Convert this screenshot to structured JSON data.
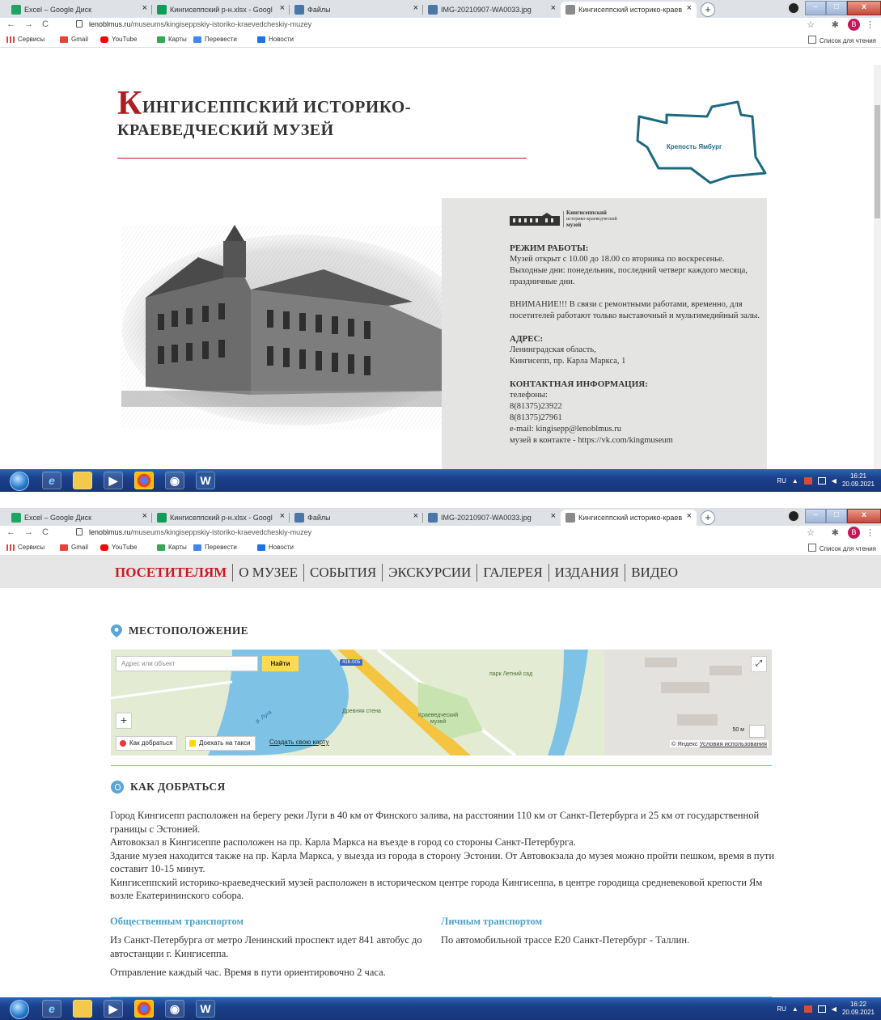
{
  "browser": {
    "tabs": [
      {
        "label": "Excel – Google Диск",
        "icon": "google-drive-icon",
        "color": "#1fa463"
      },
      {
        "label": "Кингисеппский р-н.xlsx - Googl",
        "icon": "google-sheets-icon",
        "color": "#0f9d58"
      },
      {
        "label": "Файлы",
        "icon": "vk-icon",
        "color": "#4a76a8"
      },
      {
        "label": "IMG-20210907-WA0033.jpg",
        "icon": "vk-icon",
        "color": "#4a76a8"
      },
      {
        "label": "Кингисеппский историко-краев",
        "icon": "site-favicon",
        "color": "#8a8a8a"
      }
    ],
    "url_host": "lenoblmus.ru",
    "url_path": "/museums/kingiseppskiy-istoriko-kraevedcheskiy-muzey",
    "avatar_letter": "B",
    "bookmarks": [
      "Сервисы",
      "Gmail",
      "YouTube",
      "Карты",
      "Перевести",
      "Новости"
    ],
    "reading_list": "Список для чтения"
  },
  "taskbar": {
    "lang": "RU",
    "shot1_time": "16:21",
    "shot1_date": "20.09.2021",
    "shot2_time": "16:22",
    "shot2_date": "20.09.2021"
  },
  "header": {
    "title_first_letter": "К",
    "title_line1_rest": "ИНГИСЕППСКИЙ ИСТОРИКО-",
    "title_line2": "КРАЕВЕДЧЕСКИЙ МУЗЕЙ",
    "fortress_label": "Крепость Ямбург"
  },
  "info": {
    "logo_line1": "Кингисеппский",
    "logo_line2": "историко-краеведческий",
    "logo_line3": "музей",
    "hours_title": "РЕЖИМ РАБОТЫ:",
    "hours_text": "Музей открыт с 10.00 до 18.00 со вторника по воскресенье. Выходные дни: понедельник, последний четверг каждого месяца, праздничные дни.",
    "notice_text": "ВНИМАНИЕ!!! В связи с ремонтными работами, временно, для посетителей работают только выставочный и мультимедийный залы.",
    "address_title": "АДРЕС:",
    "address_line1": "Ленинградская область,",
    "address_line2": "Кингисепп, пр. Карла Маркса, 1",
    "contact_title": "КОНТАКТНАЯ ИНФОРМАЦИЯ:",
    "phones_label": "телефоны:",
    "phone1": "8(81375)23922",
    "phone2": "8(81375)27961",
    "email": "e-mail: kingisepp@lenoblmus.ru",
    "vk": "музей в контакте - https://vk.com/kingmuseum"
  },
  "nav": {
    "items": [
      "ПОСЕТИТЕЛЯМ",
      "О МУЗЕЕ",
      "СОБЫТИЯ",
      "ЭКСКУРСИИ",
      "ГАЛЕРЕЯ",
      "ИЗДАНИЯ",
      "ВИДЕО"
    ],
    "active": "ПОСЕТИТЕЛЯМ",
    "active_color": "#c8181f"
  },
  "location": {
    "title": "МЕСТОПОЛОЖЕНИЕ"
  },
  "map": {
    "search_placeholder": "Адрес или объект",
    "find_label": "Найти",
    "route_button": "Как добраться",
    "taxi_button": "Доехать на такси",
    "create_map": "Создать свою карту",
    "road_tag": "41К-005",
    "park_label": "парк Летний сад",
    "wall_label": "Древняя стена",
    "museum_label_1": "Краеведческий",
    "museum_label_2": "музей",
    "river_label": "р. Луга",
    "scale": "50 м",
    "copyright": "© Яндекс",
    "terms": "Условия использования"
  },
  "directions": {
    "title": "КАК ДОБРАТЬСЯ",
    "p1": "Город Кингисепп расположен на берегу реки Луги в 40 км от Финского залива, на расстоянии 110 км от Санкт-Петербурга и 25 км от государственной границы с Эстонией.",
    "p2": "Автовокзал в Кингисеппе расположен на пр. Карла Маркса на въезде в город со стороны Санкт-Петербурга.",
    "p3": "Здание музея находится также на пр. Карла Маркса, у выезда из города в сторону Эстонии. От Автовокзала до музея можно пройти пешком, время в пути составит 10-15 минут.",
    "p4": "Кингисеппский историко-краеведческий музей расположен в историческом центре города Кингисеппа, в центре городища средневековой крепости Ям возле Екатерининского собора.",
    "public_title": "Общественным транспортом",
    "public_text": "Из Санкт-Петербурга от метро Ленинский проспект идет 841 автобус до автостанции г. Кингисеппа.",
    "public_text2": "Отправление каждый час. Время в пути ориентировочно 2 часа.",
    "car_title": "Личным транспортом",
    "car_text": "По автомобильной трассе Е20 Санкт-Петербург - Таллин."
  }
}
